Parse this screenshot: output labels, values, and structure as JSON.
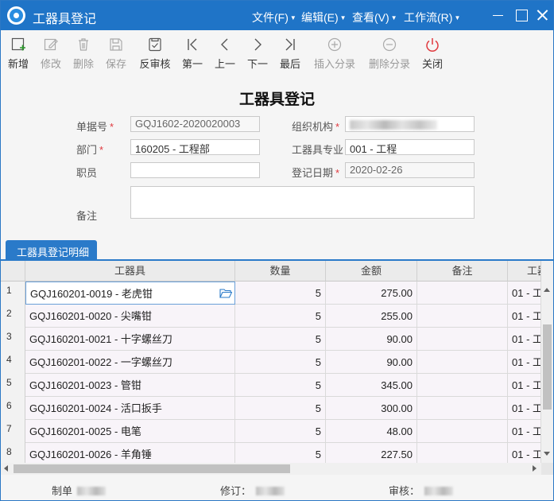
{
  "window": {
    "title": "工器具登记",
    "menus": [
      {
        "label": "文件(F)"
      },
      {
        "label": "编辑(E)"
      },
      {
        "label": "查看(V)"
      },
      {
        "label": "工作流(R)"
      }
    ]
  },
  "toolbar": {
    "buttons": [
      {
        "label": "新增",
        "icon": "add-icon",
        "enabled": true
      },
      {
        "label": "修改",
        "icon": "edit-icon",
        "enabled": false
      },
      {
        "label": "删除",
        "icon": "trash-icon",
        "enabled": false
      },
      {
        "label": "保存",
        "icon": "save-icon",
        "enabled": false
      },
      {
        "label": "反审核",
        "icon": "unaudit-icon",
        "enabled": true
      },
      {
        "label": "第一",
        "icon": "first-icon",
        "enabled": true
      },
      {
        "label": "上一",
        "icon": "prev-icon",
        "enabled": true
      },
      {
        "label": "下一",
        "icon": "next-icon",
        "enabled": true
      },
      {
        "label": "最后",
        "icon": "last-icon",
        "enabled": true
      },
      {
        "label": "插入分录",
        "icon": "plus-circle-icon",
        "enabled": false
      },
      {
        "label": "删除分录",
        "icon": "minus-circle-icon",
        "enabled": false
      },
      {
        "label": "关闭",
        "icon": "power-icon",
        "enabled": true
      }
    ]
  },
  "form": {
    "title": "工器具登记",
    "doc_no": {
      "label": "单据号",
      "value": "GQJ1602-2020020003",
      "required": true
    },
    "org": {
      "label": "组织机构",
      "value": "",
      "required": true
    },
    "dept": {
      "label": "部门",
      "value": "160205 - 工程部",
      "required": true
    },
    "tool_specialty": {
      "label": "工器具专业",
      "value": "001 - 工程"
    },
    "staff": {
      "label": "职员",
      "value": ""
    },
    "reg_date": {
      "label": "登记日期",
      "value": "2020-02-26",
      "required": true
    },
    "remark": {
      "label": "备注",
      "value": ""
    },
    "required_mark": "*"
  },
  "tab": {
    "label": "工器具登记明细"
  },
  "grid": {
    "columns": [
      "工器具",
      "数量",
      "金额",
      "备注",
      "工器"
    ],
    "rows": [
      {
        "no": "1",
        "tool": "GQJ160201-0019 - 老虎钳",
        "qty": "5",
        "amount": "275.00",
        "remark": "",
        "extra": "01 - 工"
      },
      {
        "no": "2",
        "tool": "GQJ160201-0020 - 尖嘴钳",
        "qty": "5",
        "amount": "255.00",
        "remark": "",
        "extra": "01 - 工"
      },
      {
        "no": "3",
        "tool": "GQJ160201-0021 - 十字螺丝刀",
        "qty": "5",
        "amount": "90.00",
        "remark": "",
        "extra": "01 - 工"
      },
      {
        "no": "4",
        "tool": "GQJ160201-0022 - 一字螺丝刀",
        "qty": "5",
        "amount": "90.00",
        "remark": "",
        "extra": "01 - 工"
      },
      {
        "no": "5",
        "tool": "GQJ160201-0023 - 管钳",
        "qty": "5",
        "amount": "345.00",
        "remark": "",
        "extra": "01 - 工"
      },
      {
        "no": "6",
        "tool": "GQJ160201-0024 - 活口扳手",
        "qty": "5",
        "amount": "300.00",
        "remark": "",
        "extra": "01 - 工"
      },
      {
        "no": "7",
        "tool": "GQJ160201-0025 - 电笔",
        "qty": "5",
        "amount": "48.00",
        "remark": "",
        "extra": "01 - 工"
      },
      {
        "no": "8",
        "tool": "GQJ160201-0026 - 羊角锤",
        "qty": "5",
        "amount": "227.50",
        "remark": "",
        "extra": "01 - 工"
      }
    ]
  },
  "footer": {
    "maker_label": "制单",
    "revise_label": "修订：",
    "audit_label": "审核："
  }
}
